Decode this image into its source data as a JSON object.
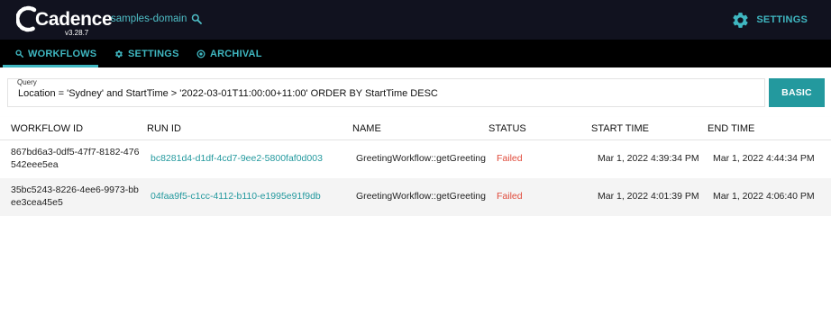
{
  "header": {
    "logo_text": "Cadence",
    "version": "v3.28.7",
    "domain": "samples-domain",
    "settings_label": "SETTINGS"
  },
  "tabs": [
    {
      "label": "WORKFLOWS",
      "active": true
    },
    {
      "label": "SETTINGS",
      "active": false
    },
    {
      "label": "ARCHIVAL",
      "active": false
    }
  ],
  "query": {
    "label": "Query",
    "value": "Location = 'Sydney' and StartTime > '2022-03-01T11:00:00+11:00' ORDER BY StartTime DESC",
    "mode_button": "BASIC"
  },
  "table": {
    "columns": [
      "WORKFLOW ID",
      "RUN ID",
      "NAME",
      "STATUS",
      "START TIME",
      "END TIME"
    ],
    "rows": [
      {
        "workflow_id": "867bd6a3-0df5-47f7-8182-476542eee5ea",
        "run_id": "bc8281d4-d1df-4cd7-9ee2-5800faf0d003",
        "name": "GreetingWorkflow::getGreeting",
        "status": "Failed",
        "start_time": "Mar 1, 2022 4:39:34 PM",
        "end_time": "Mar 1, 2022 4:44:34 PM"
      },
      {
        "workflow_id": "35bc5243-8226-4ee6-9973-bbee3cea45e5",
        "run_id": "04faa9f5-c1cc-4112-b110-e1995e91f9db",
        "name": "GreetingWorkflow::getGreeting",
        "status": "Failed",
        "start_time": "Mar 1, 2022 4:01:39 PM",
        "end_time": "Mar 1, 2022 4:06:40 PM"
      }
    ]
  },
  "colors": {
    "accent": "#3fb7c1",
    "button": "#23999e",
    "failed": "#e04a3a",
    "topbar": "#11121f",
    "tabbar": "#000000"
  },
  "icons": [
    "cadence-logo-icon",
    "search-icon",
    "gear-icon",
    "archive-icon"
  ]
}
